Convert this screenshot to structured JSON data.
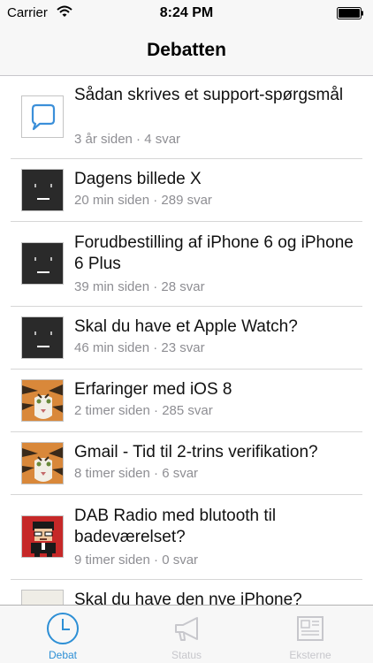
{
  "status_bar": {
    "carrier": "Carrier",
    "time": "8:24 PM"
  },
  "nav": {
    "title": "Debatten"
  },
  "topics": [
    {
      "title": "Sådan skrives et support-spørgsmål",
      "meta": "3 år siden · 4 svar",
      "avatar": "support-bubble-icon"
    },
    {
      "title": "Dagens billede X",
      "meta": "20 min siden · 289 svar",
      "avatar": "robot-face-avatar"
    },
    {
      "title": "Forudbestilling af iPhone 6 og iPhone 6 Plus",
      "meta": "39 min siden · 28 svar",
      "avatar": "robot-face-avatar"
    },
    {
      "title": "Skal du have et Apple Watch?",
      "meta": "46 min siden · 23 svar",
      "avatar": "robot-face-avatar"
    },
    {
      "title": "Erfaringer med iOS 8",
      "meta": "2 timer siden · 285 svar",
      "avatar": "tiger-avatar"
    },
    {
      "title": "Gmail - Tid til 2-trins verifikation?",
      "meta": "8 timer siden · 6 svar",
      "avatar": "tiger-avatar"
    },
    {
      "title": "DAB Radio med blutooth til badeværelset?",
      "meta": "9 timer siden · 0 svar",
      "avatar": "pixel-person-avatar"
    },
    {
      "title": "Skal du have den nye iPhone?",
      "meta": "",
      "avatar": "blank-avatar"
    }
  ],
  "tabs": [
    {
      "label": "Debat",
      "icon": "clock-icon",
      "active": true
    },
    {
      "label": "Status",
      "icon": "megaphone-icon",
      "active": false
    },
    {
      "label": "Eksterne",
      "icon": "newspaper-icon",
      "active": false
    }
  ],
  "colors": {
    "accent": "#2d8fd5",
    "meta_text": "#8e8e93",
    "inactive_tab": "#c7c7cc"
  }
}
